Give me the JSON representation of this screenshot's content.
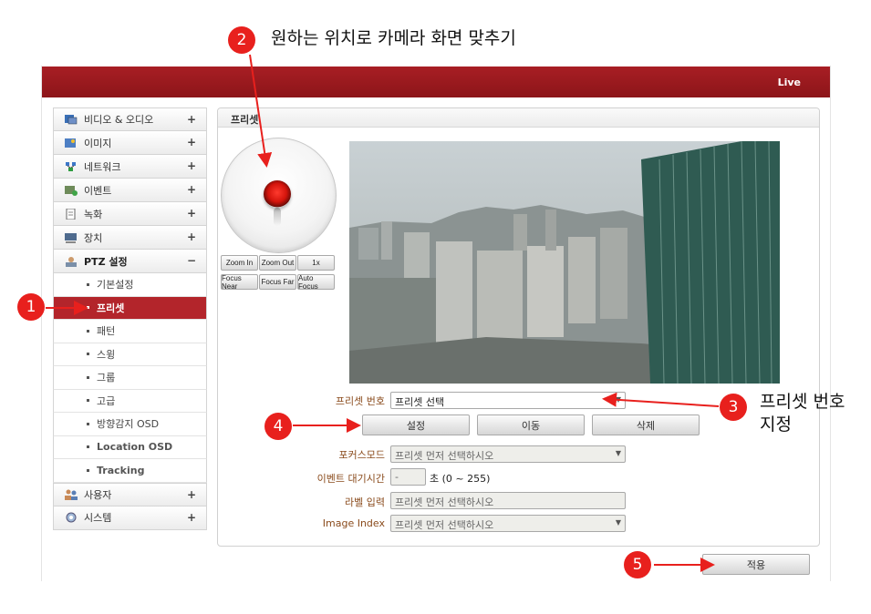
{
  "header": {
    "live_label": "Live"
  },
  "sidebar": {
    "items": [
      {
        "label": "비디오 & 오디오",
        "toggle": "+"
      },
      {
        "label": "이미지",
        "toggle": "+"
      },
      {
        "label": "네트워크",
        "toggle": "+"
      },
      {
        "label": "이벤트",
        "toggle": "+"
      },
      {
        "label": "녹화",
        "toggle": "+"
      },
      {
        "label": "장치",
        "toggle": "+"
      },
      {
        "label": "PTZ 설정",
        "toggle": "−"
      }
    ],
    "subitems": [
      "기본설정",
      "프리셋",
      "패턴",
      "스윙",
      "그룹",
      "고급",
      "방향감지 OSD",
      "Location OSD",
      "Tracking"
    ],
    "bottom_items": [
      {
        "label": "사용자",
        "toggle": "+"
      },
      {
        "label": "시스템",
        "toggle": "+"
      }
    ],
    "active_subitem": "프리셋"
  },
  "panel": {
    "title": "프리셋",
    "ptz_buttons": {
      "zoom_in": "Zoom In",
      "zoom_out": "Zoom Out",
      "zoom_1x": "1x",
      "focus_near": "Focus Near",
      "focus_far": "Focus Far",
      "auto_focus": "Auto Focus"
    },
    "form": {
      "preset_number_label": "프리셋 번호",
      "preset_number_value": "프리셋 선택",
      "set_button": "설정",
      "move_button": "이동",
      "delete_button": "삭제",
      "focus_mode_label": "포커스모드",
      "focus_mode_value": "프리셋 먼저 선택하시오",
      "event_wait_label": "이벤트 대기시간",
      "event_wait_value": "-",
      "event_wait_unit": "초 (0 ~ 255)",
      "label_input_label": "라벨 입력",
      "label_input_value": "프리셋 먼저 선택하시오",
      "image_index_label": "Image Index",
      "image_index_value": "프리셋 먼저 선택하시오"
    },
    "apply_button": "적용"
  },
  "annotations": {
    "c1": "1",
    "c2": "2",
    "c3": "3",
    "c4": "4",
    "c5": "5",
    "t2": "원하는 위치로 카메라 화면 맞추기",
    "t3_line1": "프리셋 번호",
    "t3_line2": "지정"
  },
  "colors": {
    "brand_red": "#b3252b",
    "callout_red": "#e8201d",
    "label_brown": "#8a4b1c"
  }
}
